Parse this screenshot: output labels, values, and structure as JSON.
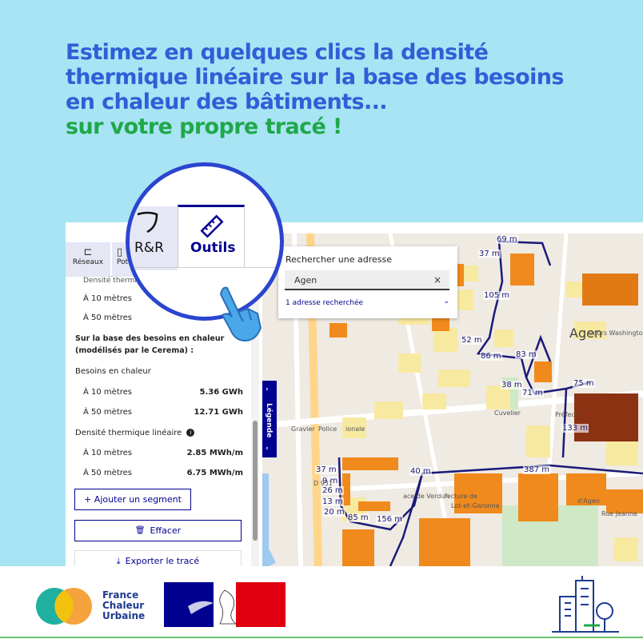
{
  "headline": {
    "line1": "Estimez en quelques clics la densité",
    "line2": "thermique linéaire sur la base des besoins",
    "line3": "en chaleur des bâtiments...",
    "line4": "sur votre propre tracé !"
  },
  "tabs": {
    "reseaux": "Réseaux",
    "potentiel": "Pote",
    "rr": "R&R",
    "outils": "Outils"
  },
  "panel": {
    "densite_cut": "Densité thermique",
    "row_10m_a": "À 10 mètres",
    "row_50m_a": "À 50 mètres",
    "besoins_intro": "Sur la base des besoins en chaleur",
    "besoins_intro2": "(modélisés par le Cerema) :",
    "besoins_title": "Besoins en chaleur",
    "besoins_10_label": "À 10 mètres",
    "besoins_10_value": "5.36 GWh",
    "besoins_50_label": "À 50 mètres",
    "besoins_50_value": "12.71 GWh",
    "densite_title": "Densité thermique linéaire",
    "densite_10_label": "À 10 mètres",
    "densite_10_value": "2.85 MWh/m",
    "densite_50_label": "À 50 mètres",
    "densite_50_value": "6.75 MWh/m",
    "add_segment": "+ Ajouter un segment",
    "effacer": "Effacer",
    "exporter": "Exporter le tracé"
  },
  "legend_tab": "Légende",
  "search": {
    "title": "Rechercher une adresse",
    "value": "Agen",
    "clear": "×",
    "recent": "1 adresse recherchée",
    "chevron": "⌄"
  },
  "map": {
    "city": "Agen",
    "labels": [
      "69 m",
      "37 m",
      "105 m",
      "52 m",
      "86 m",
      "83 m",
      "38 m",
      "71 m",
      "75 m",
      "133 m",
      "37 m",
      "9 m",
      "26 m",
      "13 m",
      "20 m",
      "85 m",
      "156 m",
      "40 m",
      "387 m"
    ],
    "places": [
      "Gravier",
      "Police",
      "ionale",
      "Cuvelier",
      "Préfect",
      "D 931",
      "ace de Verdun",
      "fecture de",
      "Lot-et-Garonne",
      "Rue Jeanne",
      "d'Agen",
      "Cours Washington"
    ],
    "route_color": "#1a1a7a"
  },
  "footer": {
    "brand1": "France",
    "brand2": "Chaleur",
    "brand3": "Urbaine"
  },
  "colors": {
    "headline_blue": "#2f5fd7",
    "headline_green": "#1fa84a",
    "background": "#a8e4f3",
    "dsfr_blue": "#000091",
    "magnifier": "#2b45cf"
  }
}
